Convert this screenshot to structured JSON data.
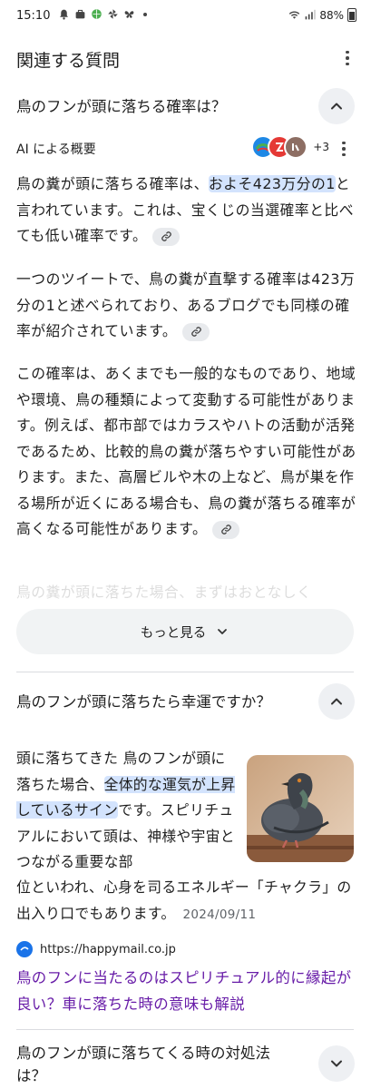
{
  "status": {
    "time": "15:10",
    "battery": "88%"
  },
  "section": {
    "title": "関連する質問"
  },
  "questions": [
    {
      "text": "鳥のフンが頭に落ちる確率は？",
      "state": "expanded"
    },
    {
      "text": "鳥のフンが頭に落ちたら幸運ですか？",
      "state": "expanded"
    },
    {
      "text": "鳥のフンが頭に落ちてくる時の対処法は？",
      "state": "collapsed"
    }
  ],
  "ai_overview": {
    "label": "AI による概要",
    "sources_more": "+3",
    "p1_a": "鳥の糞が頭に落ちる確率は、",
    "p1_hl": "およそ423万分の1",
    "p1_b": "と言われています。これは、宝くじの当選確率と比べても低い確率です。",
    "p2": "一つのツイートで、鳥の糞が直撃する確率は423万分の1と述べられており、あるブログでも同様の確率が紹介されています。",
    "p3": "この確率は、あくまでも一般的なものであり、地域や環境、鳥の種類によって変動する可能性があります。例えば、都市部ではカラスやハトの活動が活発であるため、比較的鳥の糞が落ちやすい可能性があります。また、高層ビルや木の上など、鳥が巣を作る場所が近くにある場合も、鳥の糞が落ちる確率が高くなる可能性があります。",
    "p4_faded": "鳥の糞が頭に落ちた場合、まずはおとなしく",
    "show_more": "もっと見る"
  },
  "answer2": {
    "text_a": "頭に落ちてきた 鳥のフンが頭に落ちた場合、",
    "text_hl": "全体的な運気が上昇しているサイン",
    "text_b": "です。スピリチュアルにおいて頭は、神様や宇宙とつながる重要な部",
    "text_c": "位といわれ、心身を司るエネルギー「チャクラ」の出入り口でもあります。",
    "date": "2024/09/11",
    "site": "https://happymail.co.jp",
    "link": "鳥のフンに当たるのはスピリチュアル的に縁起が良い？車に落ちた時の意味も解説"
  },
  "colors": {
    "highlight": "#d3e3fd",
    "link": "#681da8",
    "chip": "#e8eaed"
  }
}
